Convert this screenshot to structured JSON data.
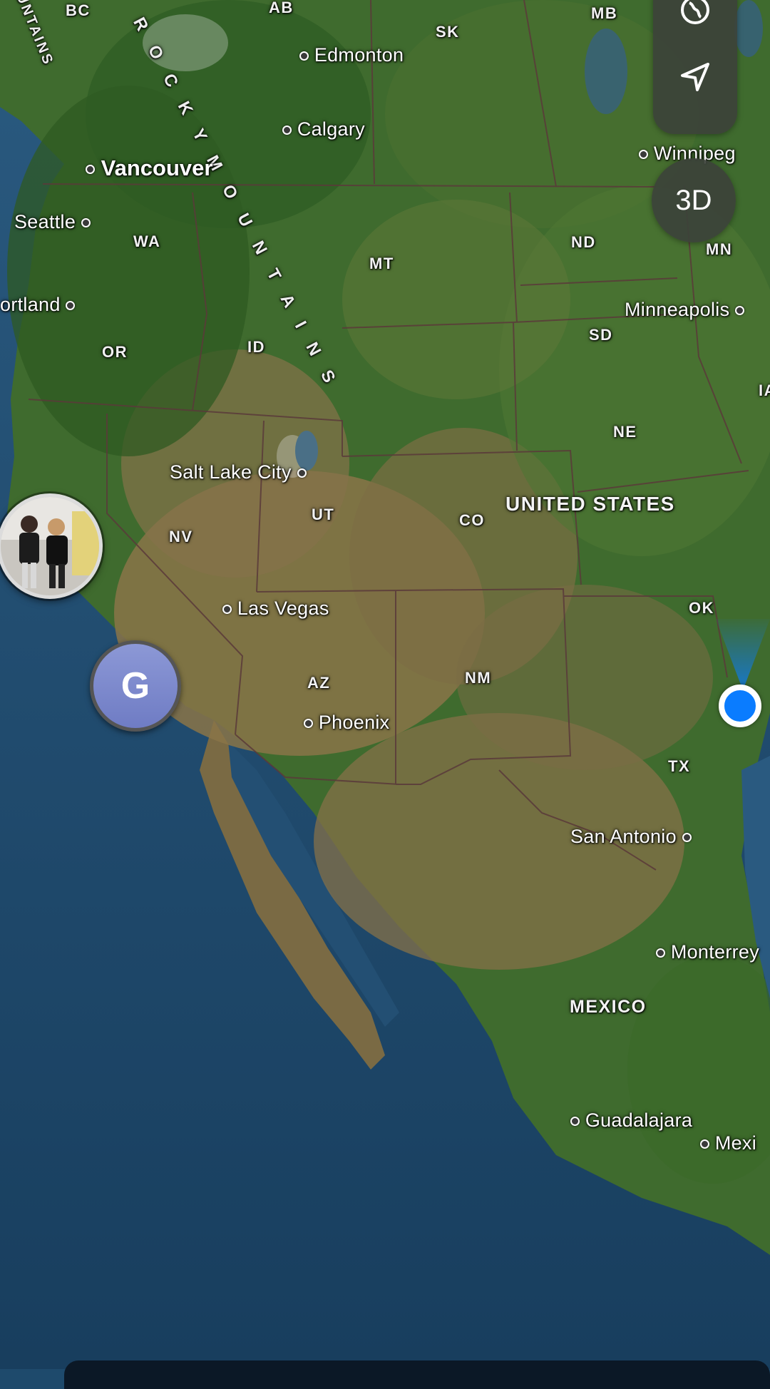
{
  "map": {
    "style": "satellite",
    "region": "Western North America",
    "colors": {
      "ocean": "#1e4a6c",
      "land_green": "#3b6a2c",
      "land_desert": "#8a7448",
      "border": "#5a3a3a",
      "user_location": "#0a7cff",
      "friend_pin": "#7a86cc"
    }
  },
  "labels": {
    "cities": [
      {
        "name": "Vancouver",
        "major": true
      },
      {
        "name": "Seattle"
      },
      {
        "name": "ortland"
      },
      {
        "name": "Edmonton"
      },
      {
        "name": "Calgary"
      },
      {
        "name": "Winnipeg"
      },
      {
        "name": "Minneapolis"
      },
      {
        "name": "Salt Lake City"
      },
      {
        "name": "Las Vegas"
      },
      {
        "name": "Phoenix"
      },
      {
        "name": "San Antonio"
      },
      {
        "name": "Monterrey"
      },
      {
        "name": "Guadalajara"
      },
      {
        "name": "Mexi"
      }
    ],
    "regions": [
      "BC",
      "AB",
      "SK",
      "MB",
      "WA",
      "MT",
      "ND",
      "MN",
      "OR",
      "ID",
      "SD",
      "NE",
      "IA",
      "UT",
      "CO",
      "NV",
      "AZ",
      "NM",
      "OK",
      "TX"
    ],
    "countries": [
      "UNITED STATES",
      "MEXICO"
    ],
    "mountains": {
      "rocky": "R O C K Y   M O U N T A I N S",
      "coast": "UNTAINS"
    }
  },
  "controls": {
    "globe_icon": "globe-icon",
    "location_icon": "location-arrow-icon",
    "view_3d_label": "3D"
  },
  "pins": {
    "friend_initial": "G",
    "photo_pin": "friend-photo"
  }
}
